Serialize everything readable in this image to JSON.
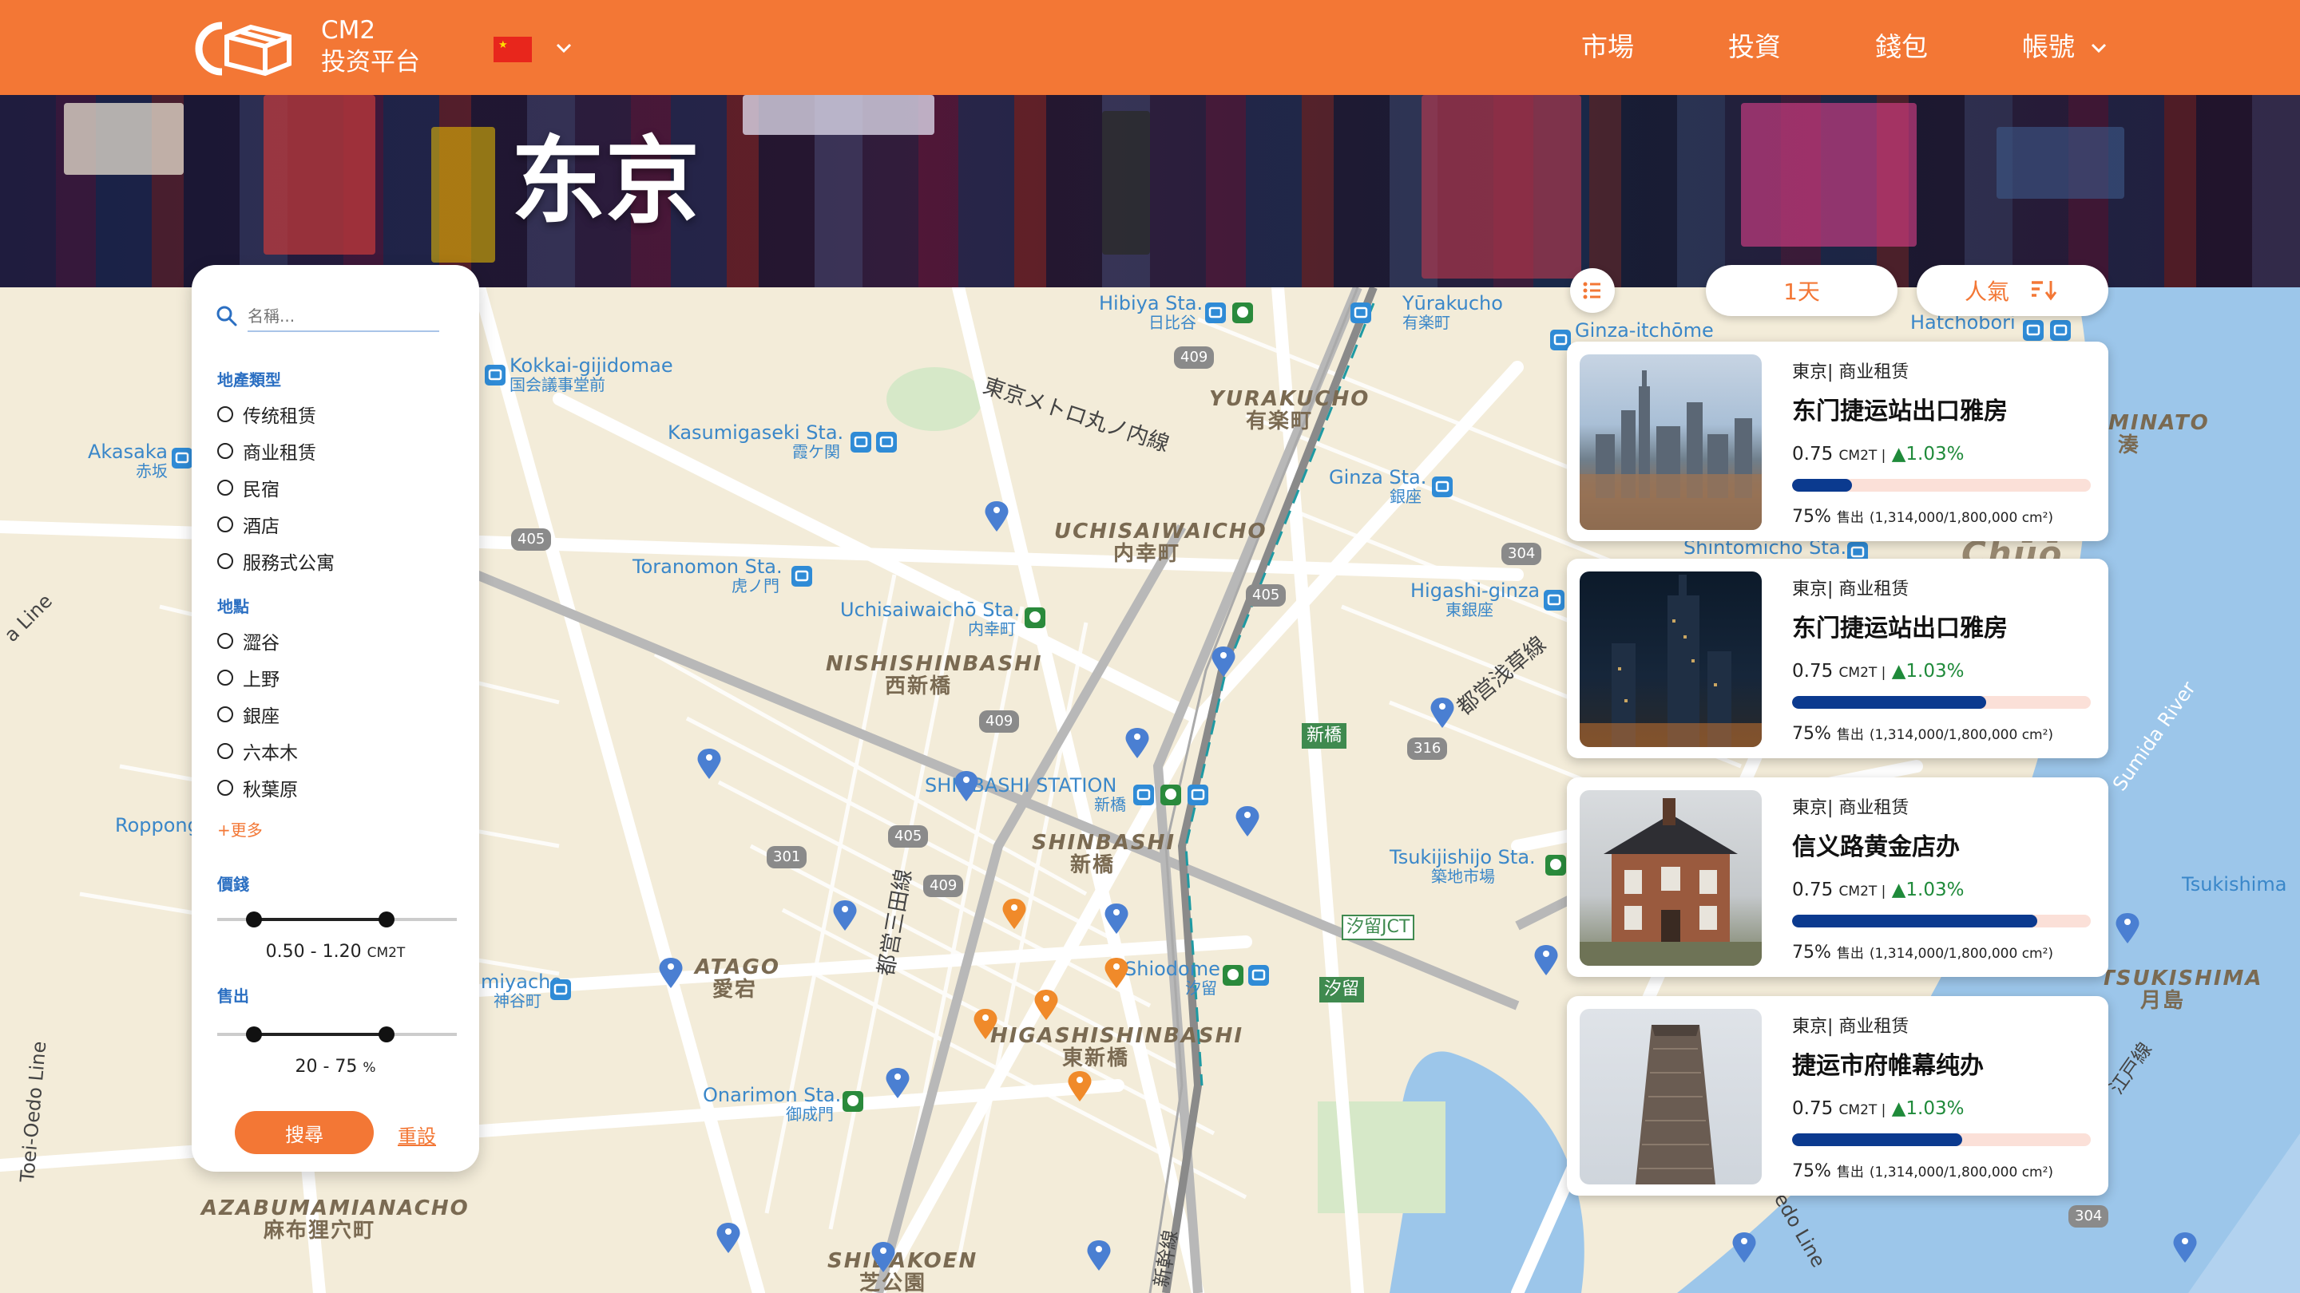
{
  "brand": {
    "line1": "CM2",
    "line2": "投资平台"
  },
  "nav": {
    "market": "市場",
    "invest": "投資",
    "wallet": "錢包",
    "account": "帳號"
  },
  "hero": {
    "city": "东京"
  },
  "filter": {
    "search_placeholder": "名稱...",
    "property_type_label": "地產類型",
    "property_types": [
      "传统租赁",
      "商业租赁",
      "民宿",
      "酒店",
      "服務式公寓"
    ],
    "location_label": "地點",
    "locations": [
      "澀谷",
      "上野",
      "銀座",
      "六本木",
      "秋葉原"
    ],
    "more_label": "+更多",
    "price_label": "價錢",
    "price_range": "0.50 - 1.20",
    "price_unit": "CM2T",
    "price_min": 0.5,
    "price_max": 1.2,
    "sold_label": "售出",
    "sold_range": "20 - 75",
    "sold_unit": "%",
    "sold_min": 20,
    "sold_max": 75,
    "search_button": "搜尋",
    "reset_button": "重設"
  },
  "controls": {
    "period": "1天",
    "sort": "人氣"
  },
  "listings": [
    {
      "category": "東京| 商业租赁",
      "title": "东门捷运站出口雅房",
      "price": "0.75",
      "unit": "CM2T |",
      "change": "▲1.03%",
      "progress": 0.2,
      "sold_pct": "75%",
      "sold_label": "售出",
      "sold_detail": "(1,314,000/1,800,000 cm²)"
    },
    {
      "category": "東京| 商业租赁",
      "title": "东门捷运站出口雅房",
      "price": "0.75",
      "unit": "CM2T |",
      "change": "▲1.03%",
      "progress": 0.65,
      "sold_pct": "75%",
      "sold_label": "售出",
      "sold_detail": "(1,314,000/1,800,000 cm²)"
    },
    {
      "category": "東京| 商业租赁",
      "title": "信义路黄金店办",
      "price": "0.75",
      "unit": "CM2T |",
      "change": "▲1.03%",
      "progress": 0.82,
      "sold_pct": "75%",
      "sold_label": "售出",
      "sold_detail": "(1,314,000/1,800,000 cm²)"
    },
    {
      "category": "東京| 商业租赁",
      "title": "捷运市府帷幕纯办",
      "price": "0.75",
      "unit": "CM2T |",
      "change": "▲1.03%",
      "progress": 0.57,
      "sold_pct": "75%",
      "sold_label": "售出",
      "sold_detail": "(1,314,000/1,800,000 cm²)"
    }
  ],
  "map_labels": {
    "hibiya": "Hibiya Sta.",
    "hibiya_jp": "日比谷",
    "yurakucho_sta": "Yūrakucho",
    "yurakucho_sta_jp": "有楽町",
    "ginza_itchome": "Ginza-itchōme",
    "hatchobori": "Hatchobori",
    "kokkai": "Kokkai-gijidomae",
    "kokkai_jp": "国会議事堂前",
    "kasumigaseki": "Kasumigaseki Sta.",
    "kasumigaseki_jp": "霞ケ関",
    "akasaka": "Akasaka",
    "akasaka_jp": "赤坂",
    "marunouchi_line": "東京メトロ丸ノ内線",
    "yurakucho_area": "YURAKUCHO",
    "yurakucho_area_jp": "有楽町",
    "uchisaiwaicho_area": "UCHISAIWAICHO",
    "uchisaiwaicho_area_jp": "内幸町",
    "ginza_sta": "Ginza Sta.",
    "ginza_sta_jp": "銀座",
    "toranomon": "Toranomon Sta.",
    "toranomon_jp": "虎ノ門",
    "uchisaiwaicho_sta": "Uchisaiwaichō Sta.",
    "uchisaiwaicho_sta_jp": "内幸町",
    "nishishinbashi": "NISHISHINBASHI",
    "nishishinbashi_jp": "西新橋",
    "higashi_ginza": "Higashi-ginza",
    "higashi_ginza_jp": "東銀座",
    "asakusa_line": "都営浅草線",
    "shintomicho": "Shintomicho Sta.",
    "chuo": "Chūō",
    "minato": "MINATO",
    "minato_jp": "湊",
    "shinbashi_sign": "新橋",
    "shinbashi_station": "SHINBASHI STATION",
    "shinbashi_station_jp": "新橋",
    "shinbashi_area": "SHINBASHI",
    "shinbashi_area_jp": "新橋",
    "ropponi": "Roppong",
    "tsukiji": "Tsukijishijo Sta.",
    "tsukiji_jp": "築地市場",
    "shiodome_jct": "汐留JCT",
    "shiodome_sign": "汐留",
    "shiodome": "Shiodome",
    "shiodome_jp": "汐留",
    "sumida": "Sumida River",
    "tsukishima_sta": "Tsukishima",
    "tsukishima_area": "TSUKISHIMA",
    "tsukishima_jp": "月島",
    "kamiyacho": "miyacho",
    "kamiyacho_jp": "神谷町",
    "atago": "ATAGO",
    "atago_jp": "愛宕",
    "higashishinbashi": "HIGASHISHINBASHI",
    "higashishinbashi_jp": "東新橋",
    "mita_line": "都営三田線",
    "onarimon": "Onarimon Sta.",
    "onarimon_jp": "御成門",
    "azabu": "AZABUMAMIANACHO",
    "azabu_jp": "麻布狸穴町",
    "shibakoen": "SHIBAKOEN",
    "shibakoen_jp": "芝公園",
    "oedo_line": "Toei-Oedo Line",
    "a_line": "a Line",
    "edo_line": "edo Line",
    "shinkansen": "新幹線",
    "edogawa_line": "江戸線",
    "r405a": "405",
    "r409a": "409",
    "r405b": "405",
    "r409b": "409",
    "r304": "304",
    "r316": "316",
    "r301": "301",
    "r405c": "405",
    "r409c": "409",
    "r304b": "304"
  },
  "colors": {
    "accent": "#f37735",
    "progress": "#0b3a8f",
    "up": "#1f8a3a"
  }
}
